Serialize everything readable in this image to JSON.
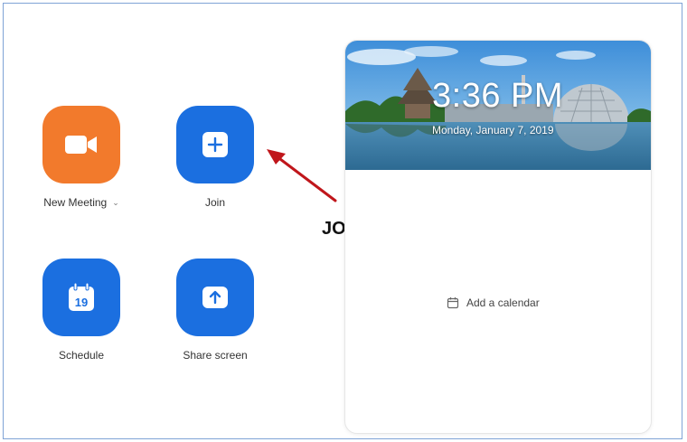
{
  "actions": [
    {
      "label": "New Meeting",
      "icon": "video-camera-icon",
      "color": "#f27a2c"
    },
    {
      "label": "Join",
      "icon": "plus-icon",
      "color": "#1b6fe0"
    },
    {
      "label": "Schedule",
      "icon": "calendar-icon",
      "color": "#1b6fe0",
      "icon_text": "19"
    },
    {
      "label": "Share screen",
      "icon": "upload-arrow-icon",
      "color": "#1b6fe0"
    }
  ],
  "clock": {
    "time": "3:36 PM",
    "date": "Monday, January 7, 2019"
  },
  "calendar": {
    "add_label": "Add a calendar"
  },
  "annotation": {
    "label": "JOIN",
    "arrow_color": "#c0161b"
  }
}
